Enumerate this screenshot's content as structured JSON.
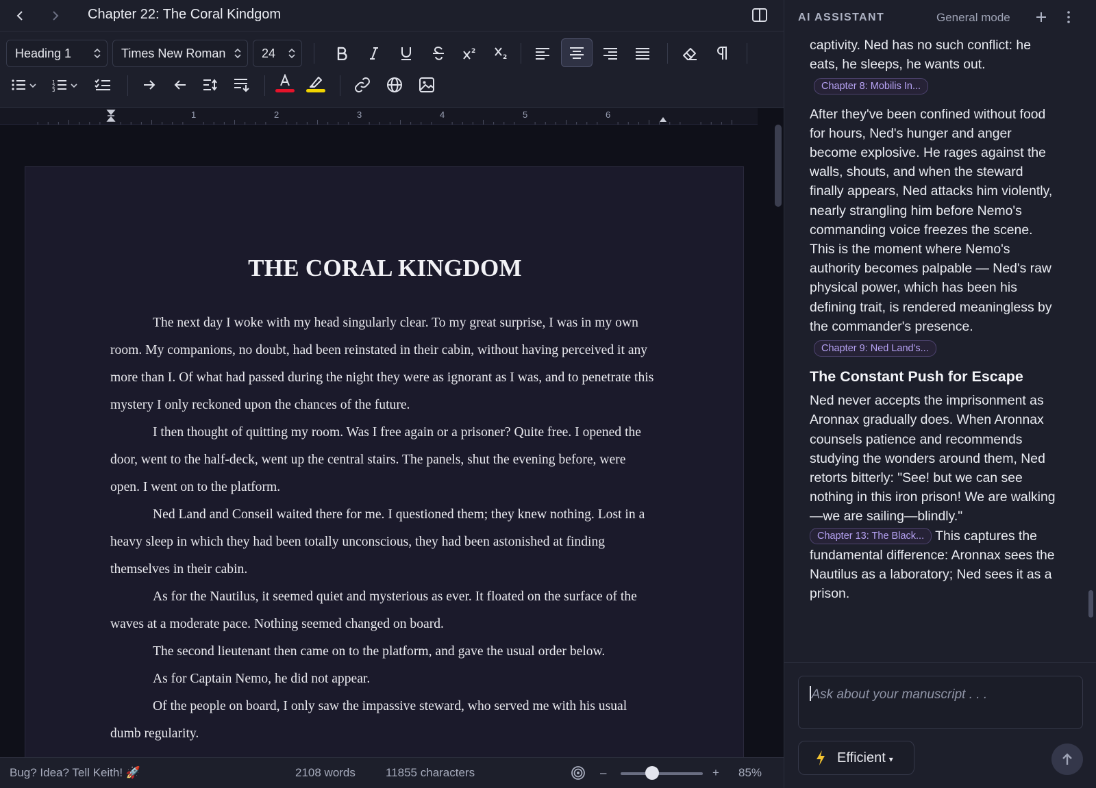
{
  "document": {
    "title": "Chapter 22: The Coral Kindgom",
    "heading": "THE CORAL KINGDOM",
    "paragraphs": [
      "The next day I woke with my head singularly clear. To my great surprise, I was in my own room. My companions, no doubt, had been reinstated in their cabin, without having perceived it any more than I. Of what had passed during the night they were as ignorant as I was, and to penetrate this mystery I only reckoned upon the chances of the future.",
      "I then thought of quitting my room. Was I free again or a prisoner? Quite free. I opened the door, went to the half-deck, went up the central stairs. The panels, shut the evening before, were open. I went on to the platform.",
      "Ned Land and Conseil waited there for me. I questioned them; they knew nothing. Lost in a heavy sleep in which they had been totally unconscious, they had been astonished at finding themselves in their cabin.",
      "As for the Nautilus, it seemed quiet and mysterious as ever. It floated on the surface of the waves at a moderate pace. Nothing seemed changed on board.",
      "The second lieutenant then came on to the platform, and gave the usual order below.",
      "As for Captain Nemo, he did not appear.",
      "Of the people on board, I only saw the impassive steward, who served me with his usual dumb regularity."
    ]
  },
  "toolbar": {
    "block_style": "Heading 1",
    "font_family": "Times New Roman",
    "font_size": "24",
    "icons": {
      "bold": "bold-icon",
      "italic": "italic-icon",
      "underline": "underline-icon",
      "strike": "strikethrough-icon",
      "superscript": "superscript-icon",
      "subscript": "subscript-icon",
      "align_left": "align-left-icon",
      "align_center": "align-center-icon",
      "align_right": "align-right-icon",
      "justify": "align-justify-icon",
      "clear": "eraser-icon",
      "pilcrow": "pilcrow-icon"
    },
    "text_color": "#e5132a",
    "highlight_color": "#f1d400"
  },
  "ruler": {
    "numbers": [
      "1",
      "2",
      "3",
      "4",
      "5",
      "6"
    ]
  },
  "status": {
    "feedback": "Bug? Idea? Tell Keith! 🚀",
    "words": "2108 words",
    "characters": "11855 characters",
    "zoom_minus": "–",
    "zoom_plus": "+",
    "zoom": "85%",
    "zoom_level": 0.38
  },
  "assistant": {
    "title": "AI ASSISTANT",
    "mode": "General mode",
    "partial_top": "captivity. Ned has no such conflict: he eats, he sleeps, he wants out.",
    "chip1": "Chapter 8: Mobilis In...",
    "para2": "After they've been confined without food for hours, Ned's hunger and anger become explosive. He rages against the walls, shouts, and when the steward finally appears, Ned attacks him violently, nearly strangling him before Nemo's commanding voice freezes the scene. This is the moment where Nemo's authority becomes palpable — Ned's raw physical power, which has been his defining trait, is rendered meaningless by the commander's presence.",
    "chip2": "Chapter 9: Ned Land's...",
    "heading": "The Constant Push for Escape",
    "para3": "Ned never accepts the imprisonment as Aronnax gradually does. When Aronnax counsels patience and recommends studying the wonders around them, Ned retorts bitterly: \"See! but we can see nothing in this iron prison! We are walking—we are sailing—blindly.\"",
    "chip3": "Chapter 13: The Black...",
    "para3b": "This captures the fundamental difference: Aronnax sees the Nautilus as a laboratory; Ned sees it as a prison.",
    "input_placeholder": "Ask about your manuscript . . .",
    "model": "Efficient",
    "model_caret": "▾"
  },
  "colors": {
    "accent_chip": "#b6a2f3",
    "background": "#0f1019",
    "panel": "#1d1f2b"
  }
}
